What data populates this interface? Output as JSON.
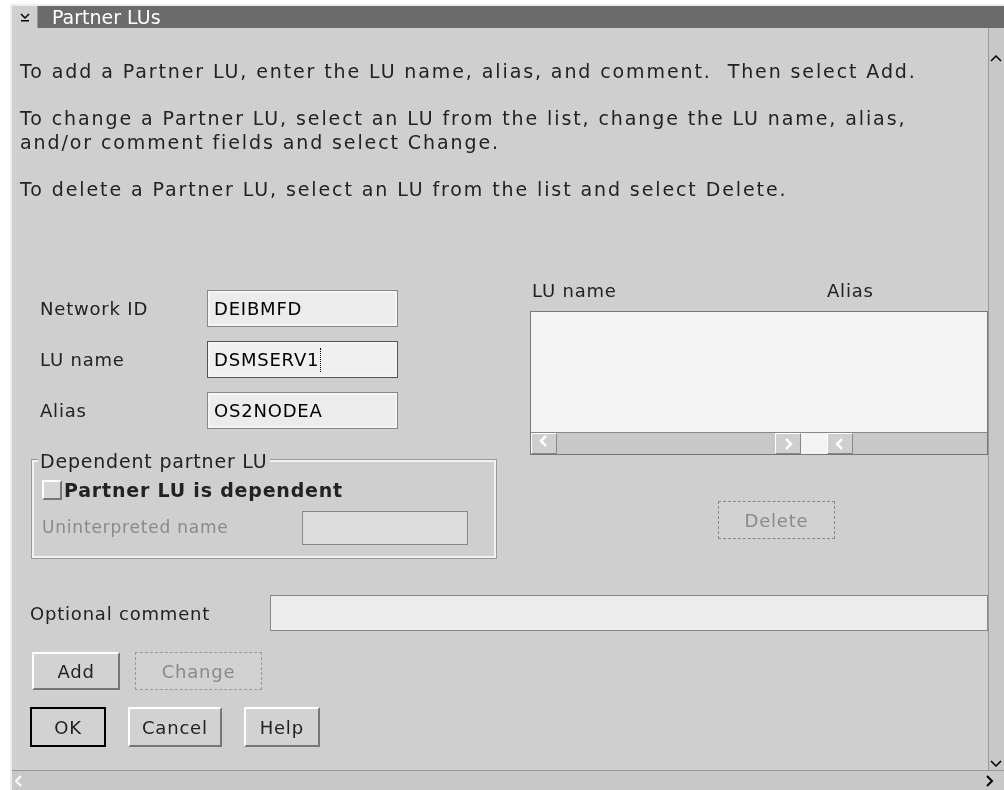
{
  "window": {
    "title": "Partner LUs"
  },
  "instructions": [
    "To add a Partner LU, enter the LU name, alias, and comment.  Then select Add.",
    "To change a Partner LU, select an LU from the list, change the LU name, alias, and/or comment fields and select Change.",
    "To delete a Partner LU, select an LU from the list and select Delete."
  ],
  "fields": [
    {
      "label": "Network ID",
      "value": "DEIBMFD",
      "focused": false
    },
    {
      "label": "LU name",
      "value": "DSMSERV1",
      "focused": true
    },
    {
      "label": "Alias",
      "value": "OS2NODEA",
      "focused": false
    }
  ],
  "dependent_group": {
    "title": "Dependent partner LU",
    "checkbox": {
      "label": "Partner LU is dependent",
      "checked": false
    },
    "uninterpreted": {
      "label": "Uninterpreted name",
      "disabled": true
    }
  },
  "list": {
    "columns": [
      "LU name",
      "Alias"
    ]
  },
  "delete_button": {
    "label": "Delete",
    "disabled": true
  },
  "comment": {
    "label": "Optional comment"
  },
  "action_buttons": [
    {
      "label": "Add",
      "disabled": false
    },
    {
      "label": "Change",
      "disabled": true
    }
  ],
  "dialog_buttons": [
    {
      "label": "OK",
      "default": true
    },
    {
      "label": "Cancel",
      "default": false
    },
    {
      "label": "Help",
      "default": false
    }
  ]
}
